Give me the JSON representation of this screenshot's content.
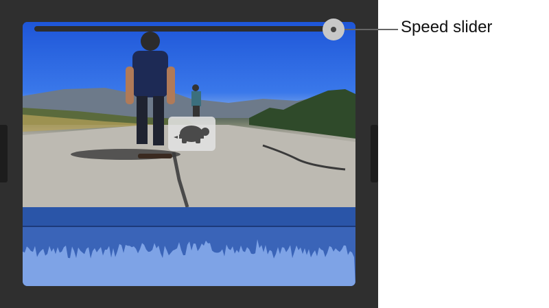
{
  "callout": {
    "label": "Speed slider"
  },
  "slider": {
    "value": 1.0
  },
  "badge": {
    "icon": "turtle-icon"
  },
  "colors": {
    "timeline_background": "#2f2f2f",
    "clip_audio": "#3a64b8",
    "waveform": "#7ea3e6",
    "knob": "#c8c8c8"
  }
}
